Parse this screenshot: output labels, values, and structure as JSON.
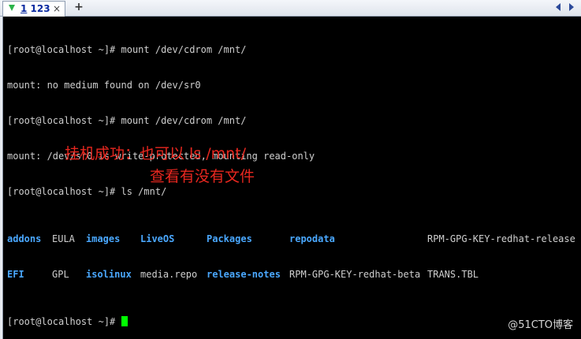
{
  "tab": {
    "number": "1",
    "title": "123",
    "close_label": "×",
    "new_tab_label": "+"
  },
  "terminal": {
    "lines": [
      "[root@localhost ~]# mount /dev/cdrom /mnt/",
      "mount: no medium found on /dev/sr0",
      "[root@localhost ~]# mount /dev/cdrom /mnt/",
      "mount: /dev/sr0 is write-protected, mounting read-only",
      "[root@localhost ~]# ls /mnt/"
    ],
    "ls_rows": [
      [
        "addons",
        "EULA",
        "images",
        "LiveOS",
        "Packages",
        "repodata",
        "RPM-GPG-KEY-redhat-release"
      ],
      [
        "EFI",
        "GPL",
        "isolinux",
        "media.repo",
        "release-notes",
        "RPM-GPG-KEY-redhat-beta",
        "TRANS.TBL"
      ]
    ],
    "prompt": "[root@localhost ~]# "
  },
  "annotation": {
    "line1": "挂机成功：也可以 ls /mnt/",
    "line2": "查看有没有文件"
  },
  "watermark": "@51CTO博客",
  "colors": {
    "background": "#000000",
    "text": "#cfcfcf",
    "directory": "#4aa8ff",
    "cursor": "#00ff00",
    "annotation": "#e8271f"
  }
}
